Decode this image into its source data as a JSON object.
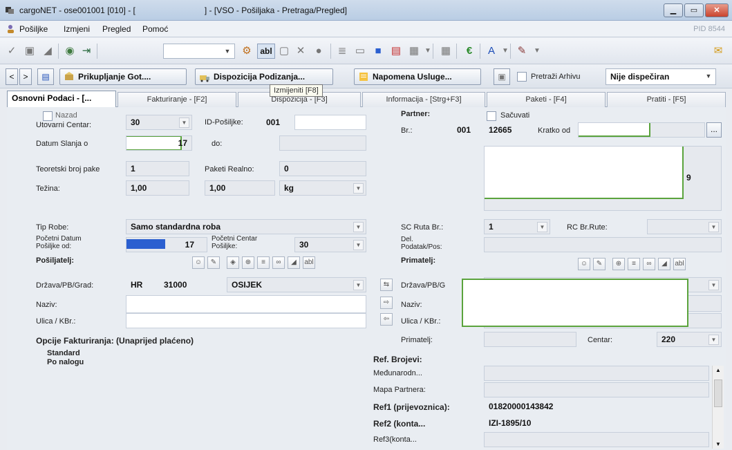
{
  "window": {
    "title_prefix": "cargoNET - ose001001 [010] - [",
    "title_suffix": "] - [VSO - Pošiljaka - Pretraga/Pregled]"
  },
  "menu": {
    "items": [
      "Pošiljke",
      "Izmjeni",
      "Pregled",
      "Pomoć"
    ],
    "pid": "PID 8544"
  },
  "toolbar": {
    "abl": "abl"
  },
  "toolbar2": {
    "prev": "<",
    "next": ">",
    "prikupljanje": "Prikupljanje Got....",
    "dispozicija": "Dispozicija Podizanja...",
    "napomena": "Napomena Usluge...",
    "pretrazi_arhivu": "Pretraži Arhivu",
    "dispecer": "Nije dispečiran"
  },
  "tooltip": "Izmijeniti [F8]",
  "tabs": [
    "Osnovni Podaci - [...",
    "Fakturiranje - [F2]",
    "Dispozicija - [F3]",
    "Informacija - [Strg+F3]",
    "Paketi - [F4]",
    "Pratiti - [F5]"
  ],
  "left": {
    "nazad": "Nazad",
    "utovarni_centar_label": "Utovarni Centar:",
    "utovarni_centar": "30",
    "id_posiljke_label": "ID-Pošiljke:",
    "id_posiljke": "001",
    "datum_slanja_label": "Datum Slanja o",
    "datum_slanja_suffix": "17",
    "do_label": "do:",
    "teor_broj_label": "Teoretski broj pake",
    "teor_broj": "1",
    "paketi_realno_label": "Paketi Realno:",
    "paketi_realno": "0",
    "tezina_label": "Težina:",
    "tezina1": "1,00",
    "tezina2": "1,00",
    "tezina_unit": "kg",
    "tip_robe_label": "Tip Robe:",
    "tip_robe": "Samo standardna roba",
    "pocetni_datum_label1": "Početni Datum",
    "pocetni_datum_label2": "Pošiljke od:",
    "pocetni_datum_suffix": "17",
    "pocetni_centar_label1": "Početni Centar",
    "pocetni_centar_label2": "Pošiljke:",
    "pocetni_centar": "30",
    "posiljatelj_label": "Pošiljatelj:",
    "drzava_label": "Država/PB/Grad:",
    "drzava": "HR",
    "pb": "31000",
    "grad": "OSIJEK",
    "naziv_label": "Naziv:",
    "ulica_label": "Ulica / KBr.:",
    "opcije_label": "Opcije Fakturiranja: (Unaprijed plaćeno)",
    "opcija1": "Standard",
    "opcija2": "Po nalogu",
    "abl": "abl"
  },
  "right": {
    "partner_label": "Partner:",
    "sacuvati": "Sačuvati",
    "br_label": "Br.:",
    "br1": "001",
    "br2": "12665",
    "kratko_label": "Kratko od",
    "partner_tail": "9",
    "sc_ruta_label": "SC Ruta Br.:",
    "sc_ruta": "1",
    "rc_label": "RC Br.Rute:",
    "del_label1": "Del.",
    "del_label2": "Podatak/Pos:",
    "primatelj_label": "Primatelj:",
    "drzava_label": "Država/PB/G",
    "naziv_label": "Naziv:",
    "ulica_label": "Ulica / KBr.:",
    "primatelj2_label": "Primatelj:",
    "centar_label": "Centar:",
    "centar": "220",
    "ref_label": "Ref. Brojevi:",
    "ref_rows": [
      {
        "label": "Međunarodn...",
        "value": "",
        "bold": false
      },
      {
        "label": "Mapa Partnera:",
        "value": "",
        "bold": false
      },
      {
        "label": "Ref1 (prijevoznica):",
        "value": "01820000143842",
        "bold": true
      },
      {
        "label": "Ref2 (konta...",
        "value": "IZI-1895/10",
        "bold": true
      },
      {
        "label": "Ref3(konta...",
        "value": "",
        "bold": false
      }
    ],
    "more": "...",
    "abl": "abl"
  }
}
